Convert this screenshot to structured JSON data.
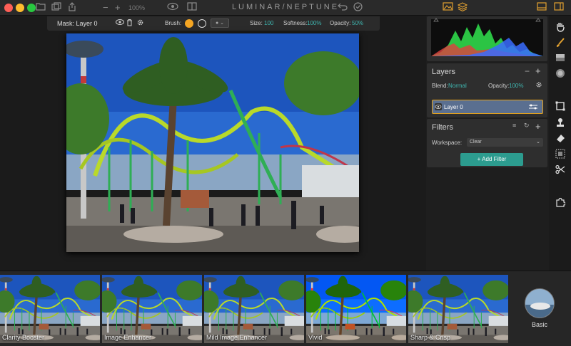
{
  "window": {
    "title": "LUMINAR/NEPTUNE",
    "zoom": "100%",
    "traffic_colors": [
      "#ff5f57",
      "#febc2e",
      "#28c840"
    ]
  },
  "mask_toolbar": {
    "mask_label": "Mask: Layer 0",
    "brush_label": "Brush:",
    "brush_color": "#f5a623",
    "size_label": "Size:",
    "size_value": "100",
    "softness_label": "Softness:",
    "softness_value": "100%",
    "opacity_label": "Opacity:",
    "opacity_value": "50%"
  },
  "layers": {
    "title": "Layers",
    "blend_label": "Blend:",
    "blend_value": "Normal",
    "opacity_label": "Opacity:",
    "opacity_value": "100%",
    "items": [
      {
        "name": "Layer 0",
        "selected": true
      }
    ]
  },
  "filters": {
    "title": "Filters",
    "workspace_label": "Workspace:",
    "workspace_value": "Clear",
    "add_filter_label": "+ Add Filter"
  },
  "tools": [
    "hand-icon",
    "brush-icon",
    "gradient-icon",
    "radial-icon",
    "crop-icon",
    "stamp-icon",
    "eraser-icon",
    "texture-icon",
    "scissors-icon",
    "puzzle-icon"
  ],
  "presets": [
    {
      "label": "Clarity Booster"
    },
    {
      "label": "Image Enhancer"
    },
    {
      "label": "Mild Image Enhancer"
    },
    {
      "label": "Vivid"
    },
    {
      "label": "Sharp & Crisp"
    }
  ],
  "preset_category": {
    "label": "Basic"
  },
  "colors": {
    "accent": "#3fb6b0",
    "add_filter": "#2c9c8f",
    "layer_selected": "#5a6f90",
    "layer_border": "#e6a21a"
  }
}
